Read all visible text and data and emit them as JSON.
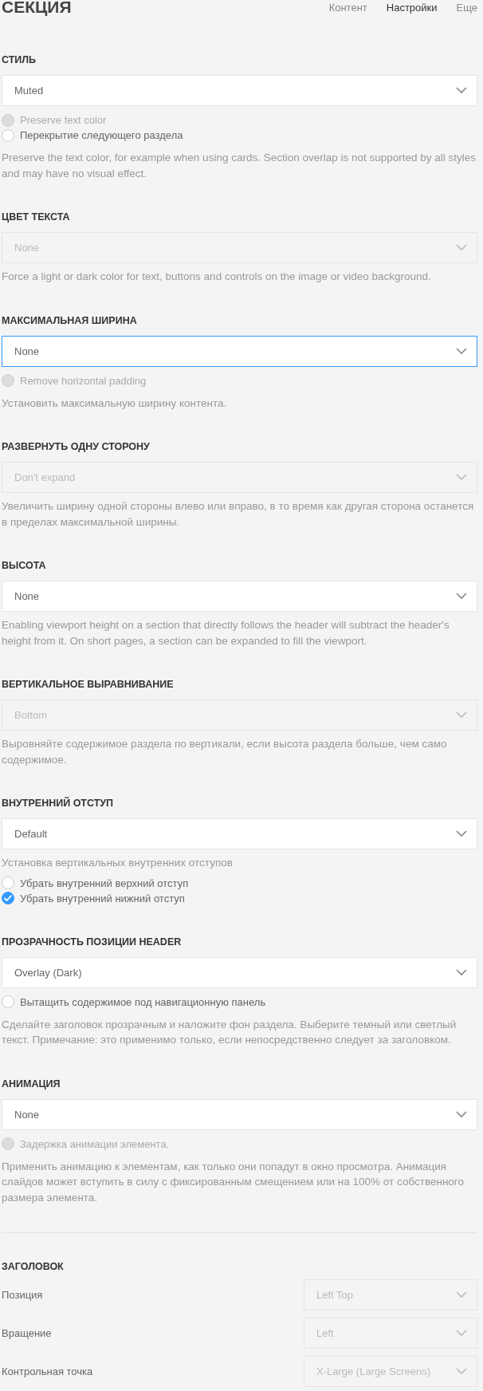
{
  "title": "СЕКЦИЯ",
  "tabs": [
    {
      "label": "Контент",
      "selected": false
    },
    {
      "label": "Настройки",
      "selected": true
    },
    {
      "label": "Еще",
      "selected": false
    }
  ],
  "sections": [
    {
      "label": "СТИЛЬ",
      "items": [
        {
          "kind": "select",
          "value": "Muted",
          "disabled": false,
          "focused": false
        },
        {
          "kind": "checkbox",
          "label": "Preserve text color",
          "checked": false,
          "disabled": true
        },
        {
          "kind": "checkbox",
          "label": "Перекрытие следующего раздела",
          "checked": false,
          "disabled": false
        },
        {
          "kind": "help",
          "text": "Preserve the text color, for example when using cards. Section overlap is not supported by all styles and may have no visual effect."
        }
      ]
    },
    {
      "label": "ЦВЕТ ТЕКСТА",
      "items": [
        {
          "kind": "select",
          "value": "None",
          "disabled": true,
          "focused": false
        },
        {
          "kind": "help",
          "text": "Force a light or dark color for text, buttons and controls on the image or video background."
        }
      ]
    },
    {
      "label": "МАКСИМАЛЬНАЯ ШИРИНА",
      "items": [
        {
          "kind": "select",
          "value": "None",
          "disabled": false,
          "focused": true
        },
        {
          "kind": "checkbox",
          "label": "Remove horizontal padding",
          "checked": false,
          "disabled": true
        },
        {
          "kind": "help",
          "text": "Установить максимальную ширину контента."
        }
      ]
    },
    {
      "label": "РАЗВЕРНУТЬ ОДНУ СТОРОНУ",
      "items": [
        {
          "kind": "select",
          "value": "Don't expand",
          "disabled": true,
          "focused": false
        },
        {
          "kind": "help",
          "text": "Увеличить ширину одной стороны влево или вправо, в то время как другая сторона останется в пределах максимальной ширины."
        }
      ]
    },
    {
      "label": "ВЫСОТА",
      "items": [
        {
          "kind": "select",
          "value": "None",
          "disabled": false,
          "focused": false
        },
        {
          "kind": "help",
          "text": "Enabling viewport height on a section that directly follows the header will subtract the header's height from it. On short pages, a section can be expanded to fill the viewport."
        }
      ]
    },
    {
      "label": "ВЕРТИКАЛЬНОЕ ВЫРАВНИВАНИЕ",
      "items": [
        {
          "kind": "select",
          "value": "Bottom",
          "disabled": true,
          "focused": false
        },
        {
          "kind": "help",
          "text": "Выровняйте содержимое раздела по вертикали, если высота раздела больше, чем само содержимое."
        }
      ]
    },
    {
      "label": "ВНУТРЕННИЙ ОТСТУП",
      "items": [
        {
          "kind": "select",
          "value": "Default",
          "disabled": false,
          "focused": false
        },
        {
          "kind": "help",
          "text": "Установка вертикальных внутренних отступов"
        },
        {
          "kind": "checkbox",
          "label": "Убрать внутренний верхний отступ",
          "checked": false,
          "disabled": false
        },
        {
          "kind": "checkbox",
          "label": "Убрать внутренний нижний отступ",
          "checked": true,
          "disabled": false
        }
      ]
    },
    {
      "label": "ПРОЗРАЧНОСТЬ ПОЗИЦИИ HEADER",
      "items": [
        {
          "kind": "select",
          "value": "Overlay (Dark)",
          "disabled": false,
          "focused": false
        },
        {
          "kind": "checkbox",
          "label": "Вытащить содержимое под навигационную панель",
          "checked": false,
          "disabled": false
        },
        {
          "kind": "help",
          "text": "Сделайте заголовок прозрачным и наложите фон раздела. Выберите темный или светлый текст. Примечание: это применимо только, если непосредственно следует за заголовком."
        }
      ]
    },
    {
      "label": "АНИМАЦИЯ",
      "items": [
        {
          "kind": "select",
          "value": "None",
          "disabled": false,
          "focused": false
        },
        {
          "kind": "checkbox",
          "label": "Задержка анимации элемента.",
          "checked": false,
          "disabled": true
        },
        {
          "kind": "help",
          "text": "Применить анимацию к элементам, как только они попадут в окно просмотра. Анимация слайдов может вступить в силу с фиксированным смещением или на 100% от собственного размера элемента."
        }
      ]
    }
  ],
  "heading": {
    "label": "ЗАГОЛОВОК",
    "rows": [
      {
        "label": "Позиция",
        "value": "Left Top",
        "disabled": true
      },
      {
        "label": "Вращение",
        "value": "Left",
        "disabled": true
      },
      {
        "label": "Контрольная точка",
        "value": "X-Large (Large Screens)",
        "disabled": true
      }
    ]
  }
}
